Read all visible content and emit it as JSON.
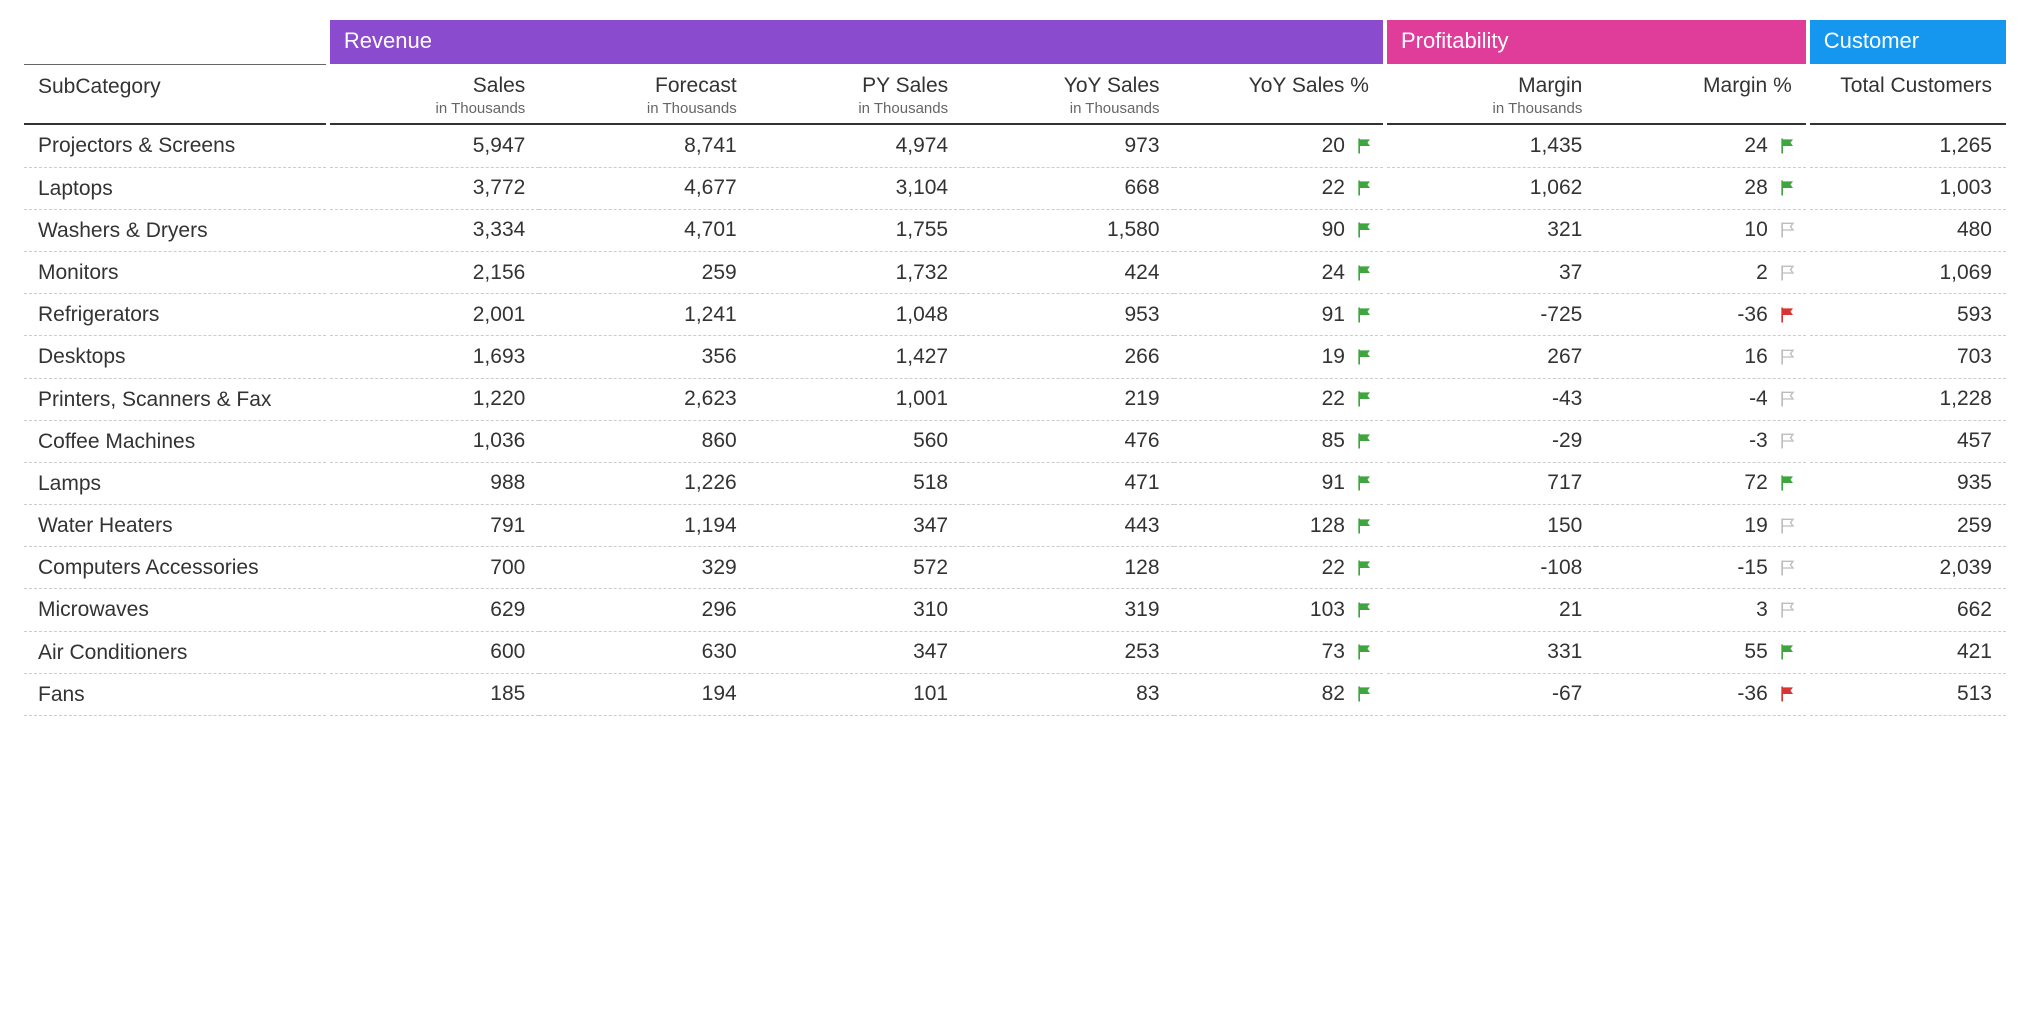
{
  "groups": {
    "revenue": "Revenue",
    "profitability": "Profitability",
    "customer": "Customer"
  },
  "columns": {
    "subcategory": {
      "label": "SubCategory"
    },
    "sales": {
      "label": "Sales",
      "sub": "in Thousands"
    },
    "forecast": {
      "label": "Forecast",
      "sub": "in Thousands"
    },
    "py_sales": {
      "label": "PY Sales",
      "sub": "in Thousands"
    },
    "yoy_sales": {
      "label": "YoY Sales",
      "sub": "in Thousands"
    },
    "yoy_pct": {
      "label": "YoY Sales %"
    },
    "margin": {
      "label": "Margin",
      "sub": "in Thousands"
    },
    "margin_pct": {
      "label": "Margin %"
    },
    "customers": {
      "label": "Total Customers"
    }
  },
  "flag_colors": {
    "green": "#3fa63f",
    "red": "#d93434",
    "grey": "#bdbdbd"
  },
  "rows": [
    {
      "name": "Projectors & Screens",
      "sales": "5,947",
      "forecast": "8,741",
      "py": "4,974",
      "yoy": "973",
      "yoy_pct": "20",
      "yoy_flag": "green",
      "margin": "1,435",
      "margin_pct": "24",
      "margin_flag": "green",
      "cust": "1,265"
    },
    {
      "name": "Laptops",
      "sales": "3,772",
      "forecast": "4,677",
      "py": "3,104",
      "yoy": "668",
      "yoy_pct": "22",
      "yoy_flag": "green",
      "margin": "1,062",
      "margin_pct": "28",
      "margin_flag": "green",
      "cust": "1,003"
    },
    {
      "name": "Washers & Dryers",
      "sales": "3,334",
      "forecast": "4,701",
      "py": "1,755",
      "yoy": "1,580",
      "yoy_pct": "90",
      "yoy_flag": "green",
      "margin": "321",
      "margin_pct": "10",
      "margin_flag": "grey",
      "cust": "480"
    },
    {
      "name": "Monitors",
      "sales": "2,156",
      "forecast": "259",
      "py": "1,732",
      "yoy": "424",
      "yoy_pct": "24",
      "yoy_flag": "green",
      "margin": "37",
      "margin_pct": "2",
      "margin_flag": "grey",
      "cust": "1,069"
    },
    {
      "name": "Refrigerators",
      "sales": "2,001",
      "forecast": "1,241",
      "py": "1,048",
      "yoy": "953",
      "yoy_pct": "91",
      "yoy_flag": "green",
      "margin": "-725",
      "margin_pct": "-36",
      "margin_flag": "red",
      "cust": "593"
    },
    {
      "name": "Desktops",
      "sales": "1,693",
      "forecast": "356",
      "py": "1,427",
      "yoy": "266",
      "yoy_pct": "19",
      "yoy_flag": "green",
      "margin": "267",
      "margin_pct": "16",
      "margin_flag": "grey",
      "cust": "703"
    },
    {
      "name": "Printers, Scanners & Fax",
      "sales": "1,220",
      "forecast": "2,623",
      "py": "1,001",
      "yoy": "219",
      "yoy_pct": "22",
      "yoy_flag": "green",
      "margin": "-43",
      "margin_pct": "-4",
      "margin_flag": "grey",
      "cust": "1,228"
    },
    {
      "name": "Coffee Machines",
      "sales": "1,036",
      "forecast": "860",
      "py": "560",
      "yoy": "476",
      "yoy_pct": "85",
      "yoy_flag": "green",
      "margin": "-29",
      "margin_pct": "-3",
      "margin_flag": "grey",
      "cust": "457"
    },
    {
      "name": "Lamps",
      "sales": "988",
      "forecast": "1,226",
      "py": "518",
      "yoy": "471",
      "yoy_pct": "91",
      "yoy_flag": "green",
      "margin": "717",
      "margin_pct": "72",
      "margin_flag": "green",
      "cust": "935"
    },
    {
      "name": "Water Heaters",
      "sales": "791",
      "forecast": "1,194",
      "py": "347",
      "yoy": "443",
      "yoy_pct": "128",
      "yoy_flag": "green",
      "margin": "150",
      "margin_pct": "19",
      "margin_flag": "grey",
      "cust": "259"
    },
    {
      "name": "Computers Accessories",
      "sales": "700",
      "forecast": "329",
      "py": "572",
      "yoy": "128",
      "yoy_pct": "22",
      "yoy_flag": "green",
      "margin": "-108",
      "margin_pct": "-15",
      "margin_flag": "grey",
      "cust": "2,039"
    },
    {
      "name": "Microwaves",
      "sales": "629",
      "forecast": "296",
      "py": "310",
      "yoy": "319",
      "yoy_pct": "103",
      "yoy_flag": "green",
      "margin": "21",
      "margin_pct": "3",
      "margin_flag": "grey",
      "cust": "662"
    },
    {
      "name": "Air Conditioners",
      "sales": "600",
      "forecast": "630",
      "py": "347",
      "yoy": "253",
      "yoy_pct": "73",
      "yoy_flag": "green",
      "margin": "331",
      "margin_pct": "55",
      "margin_flag": "green",
      "cust": "421"
    },
    {
      "name": "Fans",
      "sales": "185",
      "forecast": "194",
      "py": "101",
      "yoy": "83",
      "yoy_pct": "82",
      "yoy_flag": "green",
      "margin": "-67",
      "margin_pct": "-36",
      "margin_flag": "red",
      "cust": "513"
    }
  ]
}
